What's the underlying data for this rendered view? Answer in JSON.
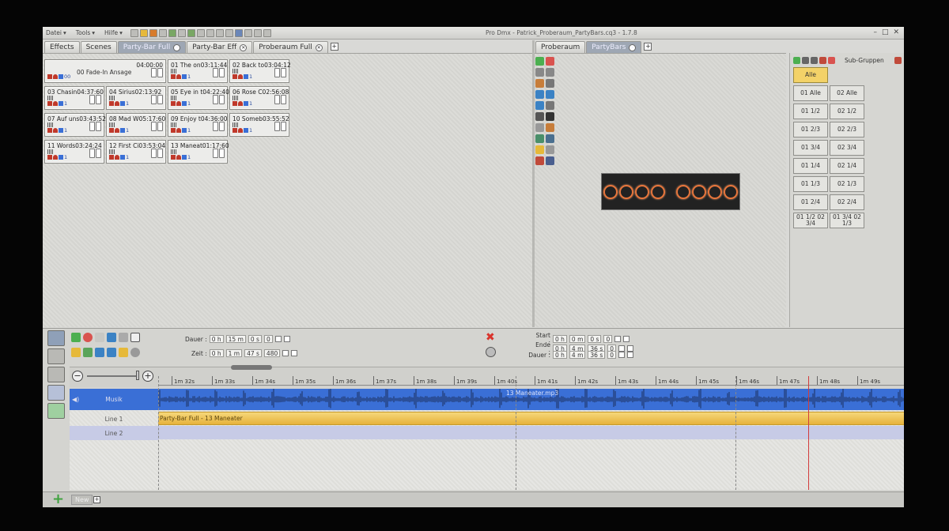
{
  "menu": {
    "items": [
      "Datei",
      "Tools",
      "Hilfe"
    ]
  },
  "app_title": "Pro Dmx - Patrick_Proberaum_PartyBars.cq3 - 1.7.8",
  "window_controls": [
    "–",
    "□",
    "✕"
  ],
  "left_tabs": [
    "Effects",
    "Scenes",
    "Party-Bar Full",
    "Party-Bar Eff",
    "Proberaum Full"
  ],
  "right_tabs": [
    "Proberaum",
    "PartyBars"
  ],
  "cues": [
    {
      "title": "00 Fade-In Ansage",
      "time": "04:00:00",
      "extra": "00"
    },
    {
      "title": "01 The on",
      "time": "03:11:44",
      "extra": "1"
    },
    {
      "title": "02 Back to",
      "time": "03:04:12",
      "extra": "1"
    },
    {
      "title": "03 Chasin",
      "time": "04:37:60",
      "extra": "1"
    },
    {
      "title": "04 Sirius",
      "time": "02:13:92",
      "extra": "1"
    },
    {
      "title": "05 Eye in t",
      "time": "04:22:40",
      "extra": "1"
    },
    {
      "title": "06 Rose C",
      "time": "02:56:08",
      "extra": "1"
    },
    {
      "title": "07 Auf uns",
      "time": "03:43:52",
      "extra": "1"
    },
    {
      "title": "08 Mad W",
      "time": "05:17:60",
      "extra": "1"
    },
    {
      "title": "09 Enjoy t",
      "time": "04:36:00",
      "extra": "1"
    },
    {
      "title": "10 Someb",
      "time": "03:55:52",
      "extra": "1"
    },
    {
      "title": "11 Words",
      "time": "03:24:24",
      "extra": "1"
    },
    {
      "title": "12 First Ci",
      "time": "03:53:04",
      "extra": "1"
    },
    {
      "title": "13 Maneat",
      "time": "01:17:60",
      "extra": "1"
    }
  ],
  "subgroups": {
    "title": "Sub-Gruppen",
    "buttons": [
      "Alle",
      "01 Alle",
      "02 Alle",
      "01 1/2",
      "02 1/2",
      "01 2/3",
      "02 2/3",
      "01 3/4",
      "02 3/4",
      "01 1/4",
      "02 1/4",
      "01 1/3",
      "02 1/3",
      "01 2/4",
      "02 2/4",
      "01 1/2 02 3/4",
      "01 3/4 02 1/3"
    ],
    "selected": "Alle"
  },
  "transport": {
    "dauer_label": "Dauer :",
    "dauer": {
      "h": "0 h",
      "m": "15 m",
      "s": "0 s",
      "f": "0"
    },
    "zeit_label": "Zeit :",
    "zeit": {
      "h": "0 h",
      "m": "1 m",
      "s": "47 s",
      "f": "480"
    }
  },
  "range": {
    "start_label": "Start :",
    "start": {
      "h": "0 h",
      "m": "0 m",
      "s": "0 s",
      "f": "0"
    },
    "ende_label": "Ende :",
    "ende": {
      "h": "0 h",
      "m": "4 m",
      "s": "36 s",
      "f": "0"
    },
    "dauer_label": "Dauer :",
    "dauer": {
      "h": "0 h",
      "m": "4 m",
      "s": "36 s",
      "f": "0"
    }
  },
  "ruler_ticks": [
    "1m 32s",
    "1m 33s",
    "1m 34s",
    "1m 35s",
    "1m 36s",
    "1m 37s",
    "1m 38s",
    "1m 39s",
    "1m 40s",
    "1m 41s",
    "1m 42s",
    "1m 43s",
    "1m 44s",
    "1m 45s",
    "1m 46s",
    "1m 47s",
    "1m 48s",
    "1m 49s"
  ],
  "tracks": {
    "music_label": "Musik",
    "music_file": "13 Maneater.mp3",
    "line1_label": "Line 1",
    "line1_clip": "Party-Bar Full - 13 Maneater",
    "line2_label": "Line 2"
  },
  "bottom_tab": "New",
  "colors": {
    "accent_blue": "#3a6fd6",
    "clip_yellow": "#e7b23b",
    "fixture_orange": "#e8763c",
    "selected_yellow": "#f3d268"
  }
}
